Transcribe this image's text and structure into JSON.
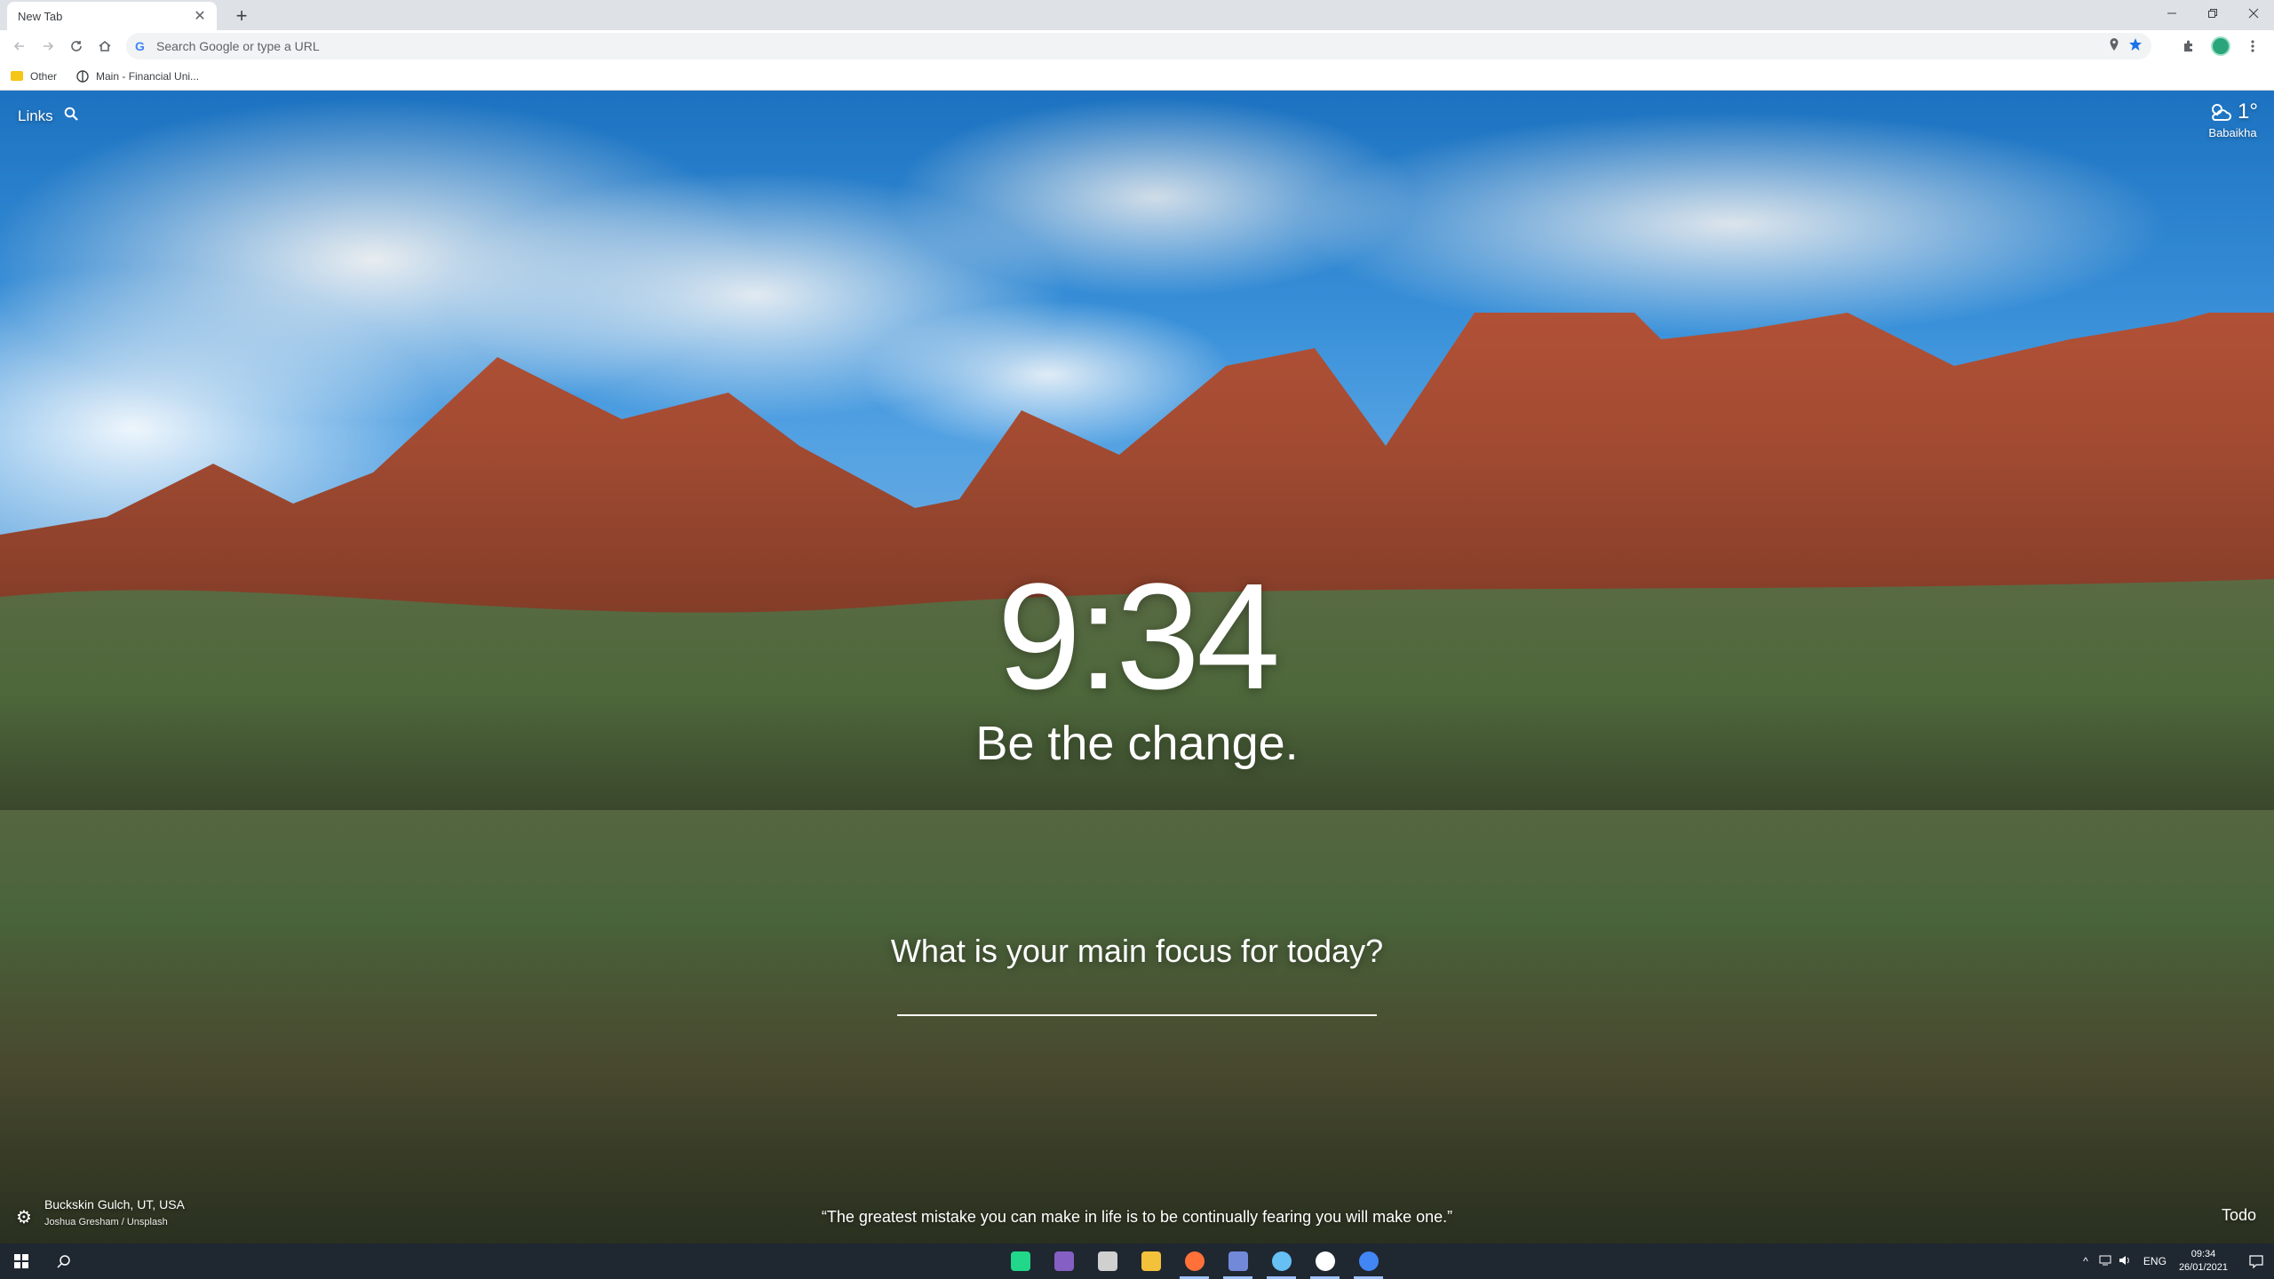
{
  "browser": {
    "tab_title": "New Tab",
    "tab_close": "✕",
    "new_tab": "+",
    "omnibox_placeholder": "Search Google or type a URL",
    "bookmarks": [
      {
        "label": "Other",
        "icon": "folder-icon"
      },
      {
        "label": "Main - Financial Uni...",
        "icon": "site-icon"
      }
    ]
  },
  "momentum": {
    "links_label": "Links",
    "weather": {
      "temperature": "1°",
      "location": "Babaikha",
      "icon": "partly-cloudy-icon"
    },
    "clock": "9:34",
    "mantra": "Be the change.",
    "focus_prompt": "What is your main focus for today?",
    "focus_value": "",
    "photo_location": "Buckskin Gulch, UT, USA",
    "photo_credit": "Joshua Gresham / Unsplash",
    "quote": "“The greatest mistake you can make in life is to be continually fearing you will make one.”",
    "todo_label": "Todo"
  },
  "taskbar": {
    "apps": [
      {
        "name": "pycharm-icon",
        "color": "#21d789"
      },
      {
        "name": "visual-studio-icon",
        "color": "#865fc5"
      },
      {
        "name": "settings-app-icon",
        "color": "#d0d0d0"
      },
      {
        "name": "file-explorer-icon",
        "color": "#f3c13a"
      },
      {
        "name": "firefox-icon",
        "color": "#ff7139"
      },
      {
        "name": "discord-icon",
        "color": "#7289da"
      },
      {
        "name": "steam-icon",
        "color": "#66c0f4"
      },
      {
        "name": "unity-hub-icon",
        "color": "#ffffff"
      },
      {
        "name": "chrome-icon",
        "color": "#4285f4"
      }
    ],
    "language": "ENG",
    "time": "09:34",
    "date": "26/01/2021"
  }
}
